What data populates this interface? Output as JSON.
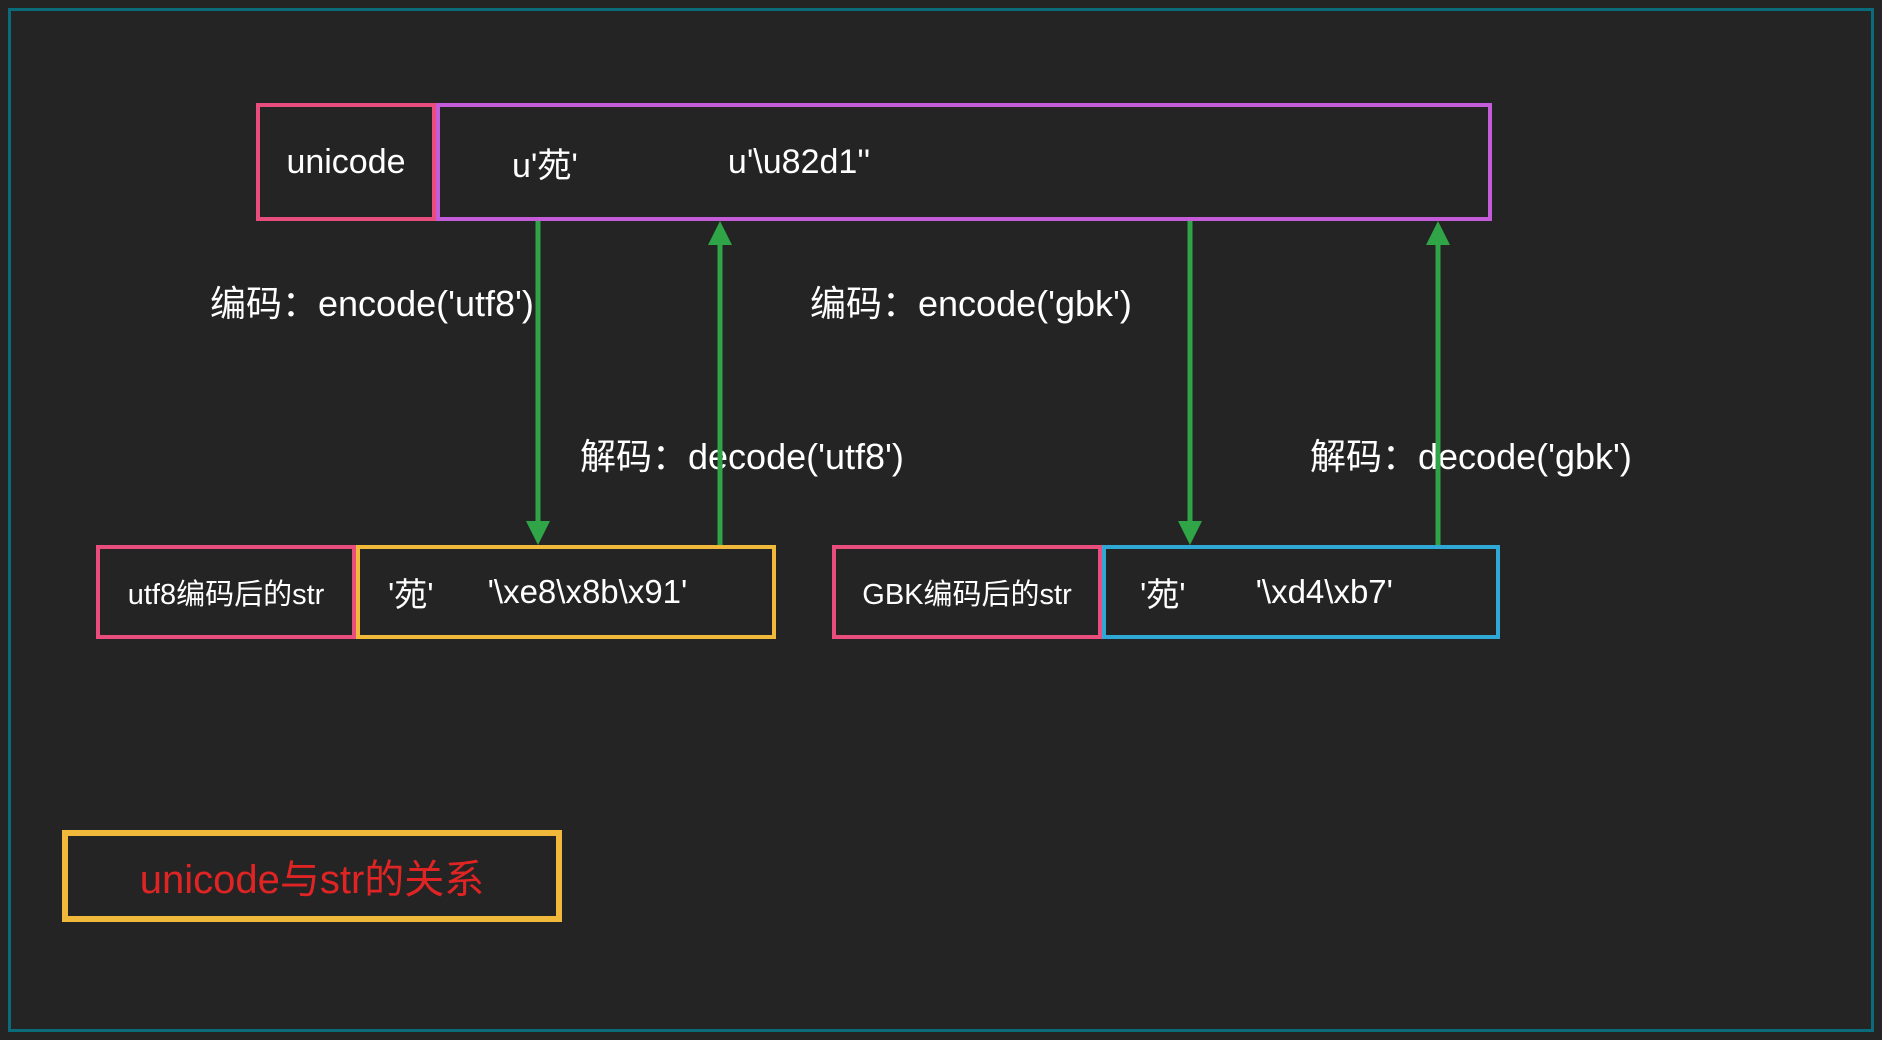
{
  "unicode": {
    "label": "unicode",
    "char": "u'苑'",
    "escape": "u'\\u82d1''"
  },
  "utf8": {
    "label": "utf8编码后的str",
    "char": "'苑'",
    "bytes": "'\\xe8\\x8b\\x91'"
  },
  "gbk": {
    "label": "GBK编码后的str",
    "char": "'苑'",
    "bytes": "'\\xd4\\xb7'"
  },
  "labels": {
    "encode_utf8": "编码：encode('utf8')",
    "encode_gbk": "编码：encode('gbk')",
    "decode_utf8": "解码：decode('utf8')",
    "decode_gbk": "解码：decode('gbk')"
  },
  "title": "unicode与str的关系",
  "colors": {
    "pink": "#e84d7d",
    "purple": "#c45bd9",
    "yellow": "#f0b93b",
    "blue": "#2fa8d6",
    "teal": "#0a6b7a",
    "red": "#e02424",
    "green": "#2fa548"
  }
}
